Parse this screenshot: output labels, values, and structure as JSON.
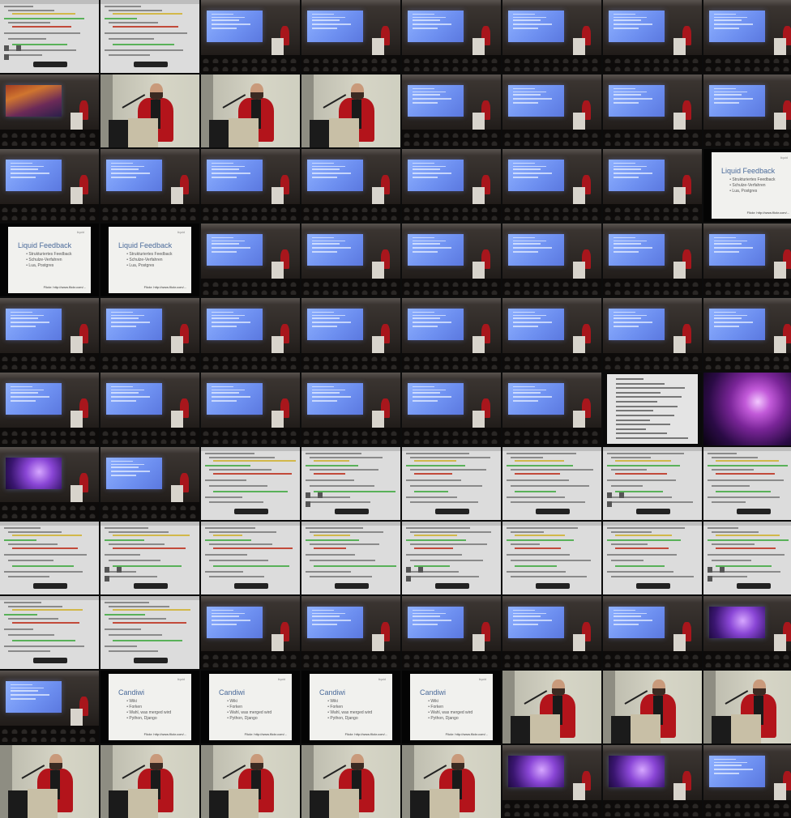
{
  "grid": {
    "columns": 8,
    "rows": 11,
    "frames": [
      "web",
      "web",
      "hall-blue",
      "hall-blue",
      "hall-blue",
      "hall-blue",
      "hall-blue",
      "hall-blue",
      "hall-sunset",
      "speaker",
      "speaker",
      "speaker",
      "hall-blue",
      "hall-blue",
      "hall-blue",
      "hall-blue",
      "hall-blue",
      "hall-blue",
      "hall-blue",
      "hall-blue",
      "hall-blue",
      "hall-blue",
      "hall-blue",
      "slide-liquid",
      "slide-liquid",
      "slide-liquid",
      "hall-blue",
      "hall-blue",
      "hall-blue",
      "hall-blue",
      "hall-blue",
      "hall-blue",
      "hall-blue",
      "hall-blue",
      "hall-blue",
      "hall-blue",
      "hall-blue",
      "hall-blue",
      "hall-blue",
      "hall-blue",
      "hall-blue",
      "hall-blue",
      "hall-blue",
      "hall-blue",
      "hall-blue",
      "hall-blue",
      "doc",
      "galaxy",
      "hall-purple",
      "hall-blue",
      "web",
      "web",
      "web",
      "web",
      "web",
      "web",
      "web",
      "web",
      "web",
      "web",
      "web",
      "web",
      "web",
      "web",
      "web",
      "web",
      "hall-blue",
      "hall-blue",
      "hall-blue",
      "hall-blue",
      "hall-blue",
      "hall-purple",
      "hall-blue",
      "slide-candiwi",
      "slide-candiwi",
      "slide-candiwi",
      "slide-candiwi",
      "speaker",
      "speaker",
      "speaker",
      "speaker",
      "speaker",
      "speaker",
      "speaker",
      "speaker",
      "hall-purple",
      "hall-purple",
      "hall-blue"
    ]
  },
  "slides": {
    "liquid": {
      "title": "Liquid Feedback",
      "bullets": [
        "Strukturiertes Feedback",
        "Schulze-Verfahren",
        "Lua, Postgres"
      ],
      "footer": "Flickr: http://www.flickr.com/..."
    },
    "candiwi": {
      "title": "Candiwi",
      "bullets": [
        "Wiki",
        "Forken",
        "Wahl, was merged wird",
        "Python, Django"
      ],
      "footer": "Flickr: http://www.flickr.com/..."
    },
    "logo": "liquid"
  },
  "colors": {
    "jacket": "#b3141b",
    "screen_blue": "#7a9bf5",
    "screen_purple": "#8a46d6",
    "slide_title": "#4a6a9a"
  }
}
